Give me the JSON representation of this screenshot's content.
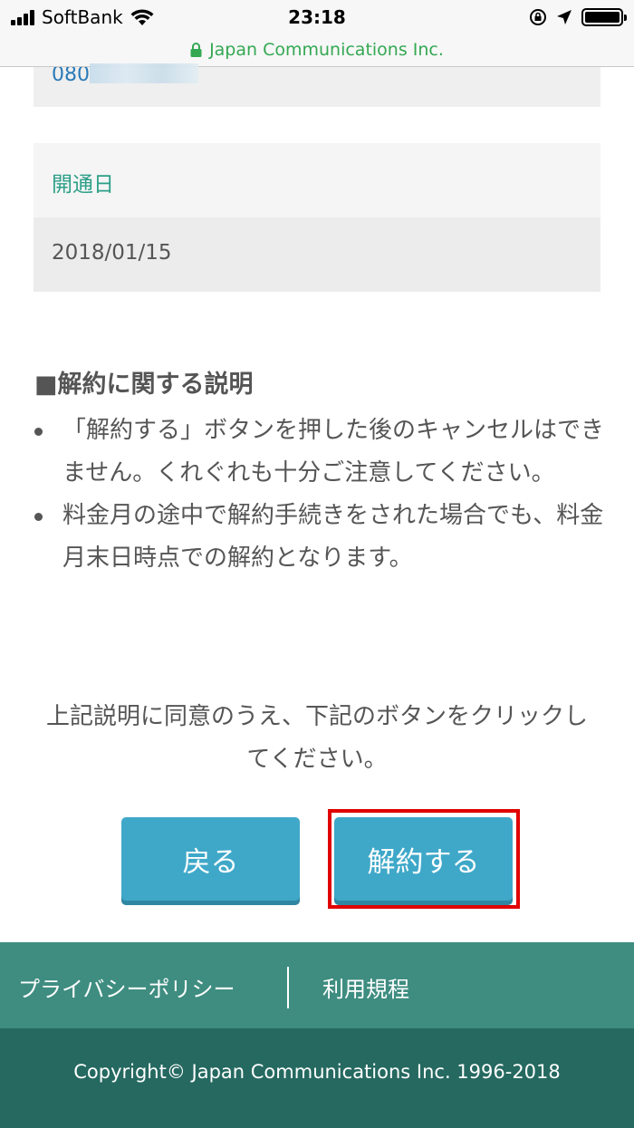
{
  "status_bar": {
    "carrier": "SoftBank",
    "time": "23:18",
    "battery_level": 1.0
  },
  "url_bar": {
    "site": "Japan Communications Inc."
  },
  "line_info": {
    "phone_partial": "080",
    "activation_label": "開通日",
    "activation_date": "2018/01/15"
  },
  "explanation": {
    "title": "■解約に関する説明",
    "items": [
      "「解約する」ボタンを押した後のキャンセルはできません。くれぐれも十分ご注意してください。",
      "料金月の途中で解約手続きをされた場合でも、料金月末日時点での解約となります。"
    ]
  },
  "agreement": {
    "text": "上記説明に同意のうえ、下記のボタンをクリックしてください。"
  },
  "buttons": {
    "back": "戻る",
    "cancel_contract": "解約する"
  },
  "footer": {
    "privacy": "プライバシーポリシー",
    "terms": "利用規程",
    "copyright": "Copyright© Japan Communications Inc. 1996-2018"
  },
  "colors": {
    "accent_button": "#3fa8c9",
    "label_green": "#2c9f87",
    "footer_top": "#3e8d80",
    "footer_bottom": "#256960",
    "highlight": "#e00000"
  }
}
